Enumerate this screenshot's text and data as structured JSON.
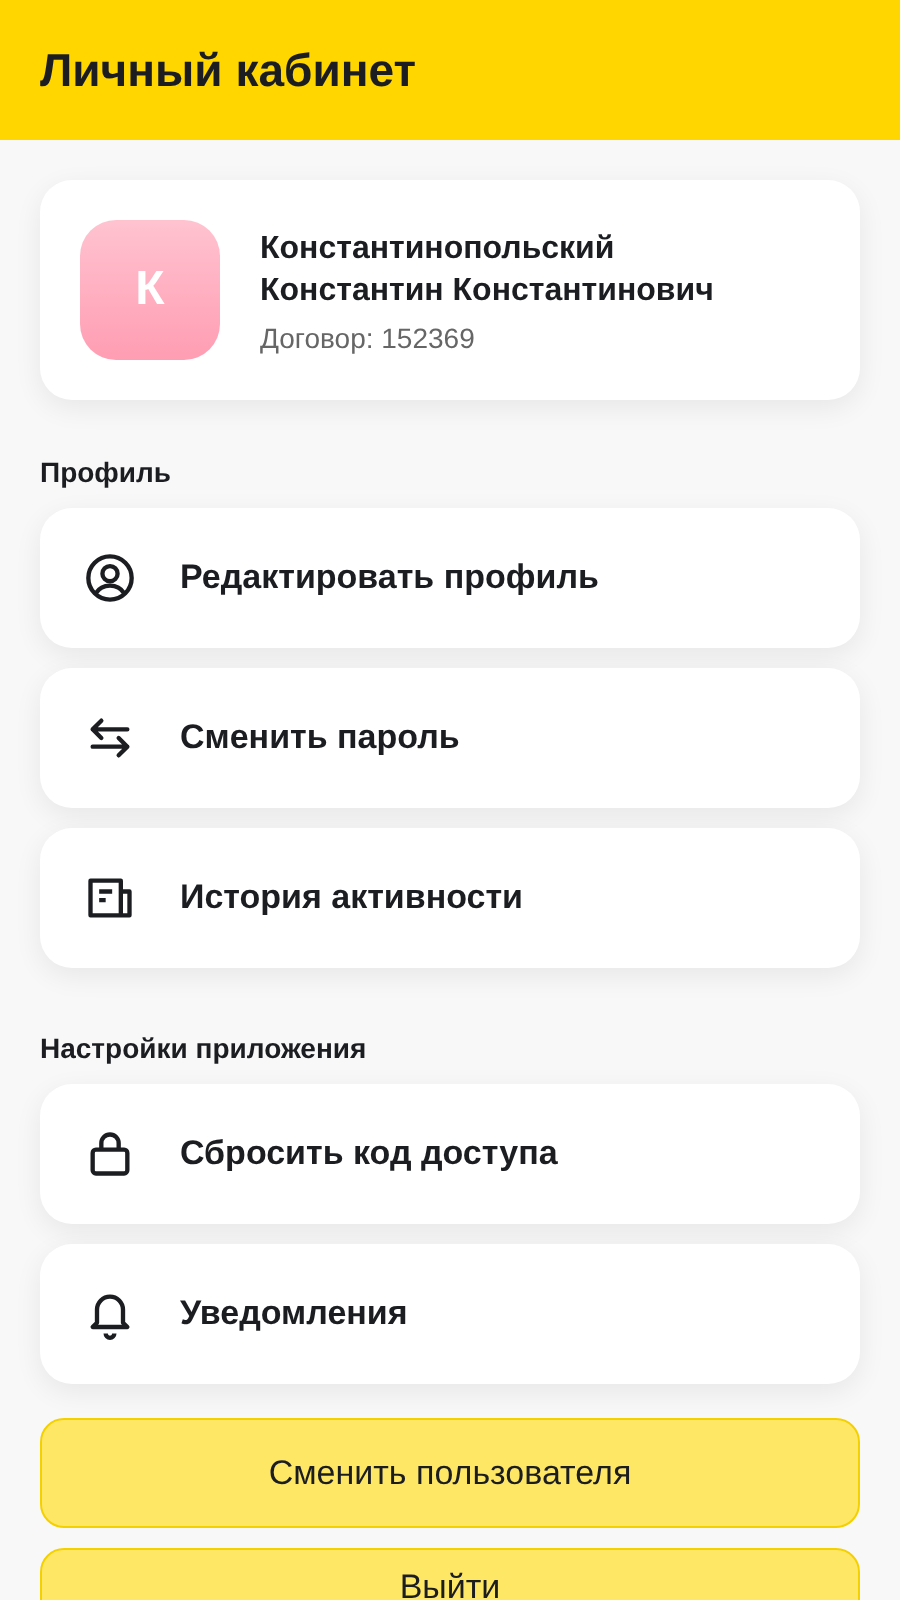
{
  "header": {
    "title": "Личный кабинет"
  },
  "profile": {
    "avatar_letter": "К",
    "name_lines": [
      "Константинопольский",
      "Константин Константинович"
    ],
    "contract": "Договор: 152369"
  },
  "sections": [
    {
      "title": "Профиль",
      "items": [
        {
          "kind": "user",
          "label": "Редактировать профиль"
        },
        {
          "kind": "swap",
          "label": "Сменить пароль"
        },
        {
          "kind": "history",
          "label": "История активности"
        }
      ]
    },
    {
      "title": "Настройки приложения",
      "items": [
        {
          "kind": "lock",
          "label": "Сбросить код доступа"
        },
        {
          "kind": "bell",
          "label": "Уведомления"
        }
      ]
    }
  ],
  "buttons": [
    "Сменить пользователя",
    "Выйти"
  ]
}
